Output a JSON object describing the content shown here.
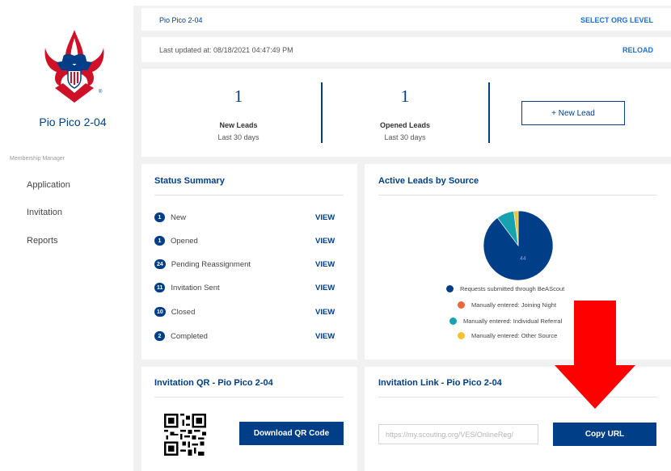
{
  "sidebar": {
    "unit_name": "Pio Pico 2-04",
    "section_label": "Membership Manager",
    "items": [
      {
        "label": "Application"
      },
      {
        "label": "Invitation"
      },
      {
        "label": "Reports"
      }
    ],
    "logo_icon": "bsa-fleur-de-lis-logo-icon"
  },
  "header": {
    "org_name": "Pio Pico 2-04",
    "select_org_level": "SELECT ORG LEVEL",
    "last_updated": "Last updated at: 08/18/2021 04:47:49 PM",
    "reload": "RELOAD"
  },
  "stats": [
    {
      "value": "1",
      "label": "New Leads",
      "sub": "Last 30 days"
    },
    {
      "value": "1",
      "label": "Opened Leads",
      "sub": "Last 30 days"
    }
  ],
  "new_lead_button": "+ New Lead",
  "status_summary": {
    "title": "Status Summary",
    "view_label": "VIEW",
    "rows": [
      {
        "count": "1",
        "label": "New"
      },
      {
        "count": "1",
        "label": "Opened"
      },
      {
        "count": "24",
        "label": "Pending Reassignment"
      },
      {
        "count": "11",
        "label": "Invitation Sent"
      },
      {
        "count": "10",
        "label": "Closed"
      },
      {
        "count": "2",
        "label": "Completed"
      }
    ]
  },
  "active_leads": {
    "title": "Active Leads by Source",
    "pie_center_label": "44",
    "legend": [
      {
        "label": "Requests submitted through BeAScout",
        "color": "#003f87"
      },
      {
        "label": "Manually entered: Joining Night",
        "color": "#e8683a"
      },
      {
        "label": "Manually entered: Individual Referral",
        "color": "#17a2b0"
      },
      {
        "label": "Manually entered: Other Source",
        "color": "#f2c230"
      }
    ]
  },
  "chart_data": {
    "type": "pie",
    "title": "Active Leads by Source",
    "categories": [
      "Requests submitted through BeAScout",
      "Manually entered: Joining Night",
      "Manually entered: Individual Referral",
      "Manually entered: Other Source"
    ],
    "values": [
      44,
      0,
      4,
      1
    ],
    "colors": [
      "#003f87",
      "#e8683a",
      "#17a2b0",
      "#f2c230"
    ]
  },
  "invitation_qr": {
    "title": "Invitation QR - Pio Pico 2-04",
    "download_label": "Download QR Code"
  },
  "invitation_link": {
    "title": "Invitation Link - Pio Pico 2-04",
    "url": "https://my.scouting.org/VES/OnlineReg/",
    "copy_label": "Copy URL"
  },
  "overlay": {
    "arrow_color": "#ff0000"
  }
}
